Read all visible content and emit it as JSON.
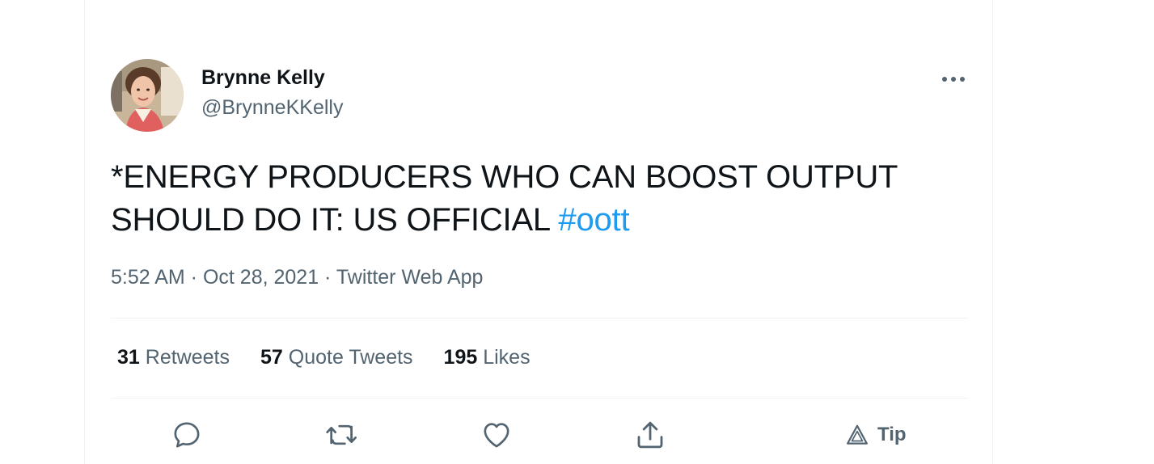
{
  "tweet": {
    "author": {
      "name": "Brynne Kelly",
      "handle": "@BrynneKKelly"
    },
    "text": "*ENERGY PRODUCERS WHO CAN BOOST OUTPUT SHOULD DO IT: US OFFICIAL ",
    "hashtag": "#oott",
    "time": "5:52 AM",
    "separator": " · ",
    "date": "Oct 28, 2021",
    "source": "Twitter Web App",
    "stats": {
      "retweets_count": "31",
      "retweets_label": "Retweets",
      "quotes_count": "57",
      "quotes_label": "Quote Tweets",
      "likes_count": "195",
      "likes_label": "Likes"
    },
    "actions": {
      "reply_icon": "reply-icon",
      "retweet_icon": "retweet-icon",
      "like_icon": "heart-icon",
      "share_icon": "share-icon",
      "tip_icon": "tip-icon",
      "tip_label": "Tip"
    },
    "more_icon": "more-horizontal-icon"
  },
  "colors": {
    "text_primary": "#0f1419",
    "text_secondary": "#536471",
    "link": "#1d9bf0",
    "divider": "#eff3f4"
  }
}
